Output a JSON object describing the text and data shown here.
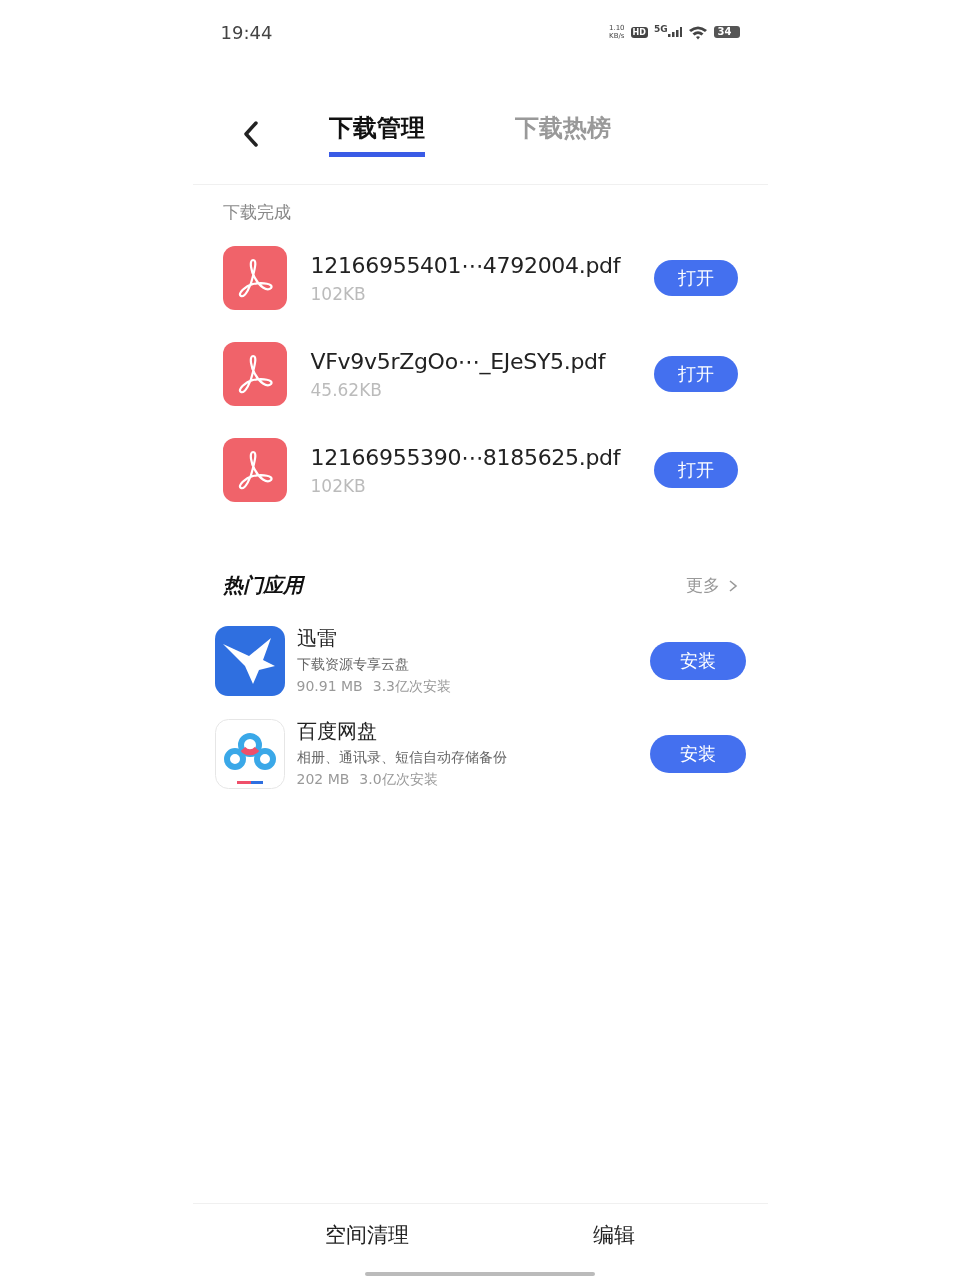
{
  "status_bar": {
    "time": "19:44",
    "speed": "1.10",
    "speed_unit": "KB/s",
    "hd": "HD",
    "network": "5G",
    "battery": "34"
  },
  "tabs": [
    {
      "label": "下载管理",
      "selected": true
    },
    {
      "label": "下载热榜",
      "selected": false
    }
  ],
  "downloads": {
    "title": "下载完成",
    "items": [
      {
        "name": "12166955401⋯4792004.pdf",
        "size": "102KB",
        "action": "打开"
      },
      {
        "name": "VFv9v5rZgOo⋯_EJeSY5.pdf",
        "size": "45.62KB",
        "action": "打开"
      },
      {
        "name": "12166955390⋯8185625.pdf",
        "size": "102KB",
        "action": "打开"
      }
    ]
  },
  "hot_apps": {
    "title": "热门应用",
    "more": "更多",
    "items": [
      {
        "name": "迅雷",
        "desc": "下载资源专享云盘",
        "size": "90.91 MB",
        "installs": "3.3亿次安装",
        "action": "安装"
      },
      {
        "name": "百度网盘",
        "desc": "相册、通讯录、短信自动存储备份",
        "size": "202 MB",
        "installs": "3.0亿次安装",
        "action": "安装"
      }
    ]
  },
  "bottom_bar": [
    "空间清理",
    "编辑"
  ]
}
